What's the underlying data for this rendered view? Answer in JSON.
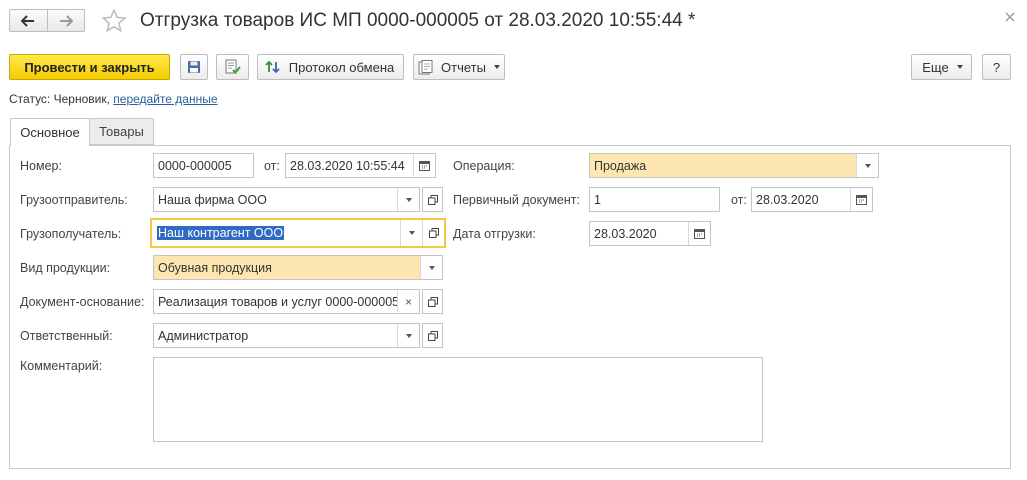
{
  "header": {
    "title": "Отгрузка товаров ИС МП 0000-000005 от 28.03.2020 10:55:44 *"
  },
  "toolbar": {
    "post_and_close": "Провести и закрыть",
    "exchange_protocol": "Протокол обмена",
    "reports": "Отчеты",
    "more": "Еще",
    "help": "?"
  },
  "status": {
    "label": "Статус:",
    "value": "Черновик,",
    "link": "передайте данные"
  },
  "tabs": [
    {
      "label": "Основное",
      "active": true
    },
    {
      "label": "Товары",
      "active": false
    }
  ],
  "form": {
    "number": {
      "label": "Номер:",
      "value": "0000-000005"
    },
    "date_from": {
      "label": "от:",
      "value": "28.03.2020 10:55:44"
    },
    "operation": {
      "label": "Операция:",
      "value": "Продажа"
    },
    "consignor": {
      "label": "Грузоотправитель:",
      "value": "Наша фирма ООО"
    },
    "primary_doc": {
      "label": "Первичный документ:",
      "value": "1"
    },
    "primary_doc_date": {
      "label": "от:",
      "value": "28.03.2020"
    },
    "consignee": {
      "label": "Грузополучатель:",
      "value": "Наш контрагент ООО"
    },
    "shipment_date": {
      "label": "Дата отгрузки:",
      "value": "28.03.2020"
    },
    "product_type": {
      "label": "Вид продукции:",
      "value": "Обувная продукция"
    },
    "base_document": {
      "label": "Документ-основание:",
      "value": "Реализация товаров и услуг 0000-000005"
    },
    "responsible": {
      "label": "Ответственный:",
      "value": "Администратор"
    },
    "comment": {
      "label": "Комментарий:",
      "value": ""
    }
  },
  "colors": {
    "primary_button": "#f4ce00",
    "required_field": "#fde6b0",
    "focus_border": "#f3c846",
    "selection": "#316ac5",
    "link": "#2a5e9c"
  }
}
